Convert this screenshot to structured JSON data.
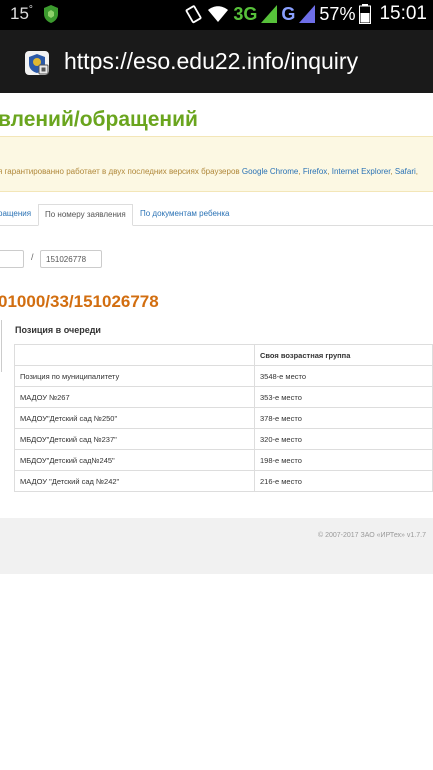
{
  "status_bar": {
    "temperature": "15",
    "temperature_unit": "°",
    "network_type": "3G",
    "network_type2": "G",
    "battery": "57%",
    "time": "15:01"
  },
  "browser": {
    "url": "https://eso.edu22.info/inquiry"
  },
  "page": {
    "title": "влений/обращений",
    "notice_prefix": "я гарантированно работает в двух последних версиях браузеров ",
    "browsers": [
      "Google Chrome",
      "Firefox",
      "Internet Explorer",
      "Safari"
    ],
    "tabs": [
      {
        "label": "ращения",
        "active": false
      },
      {
        "label": "По номеру заявления",
        "active": true
      },
      {
        "label": "По документам ребенка",
        "active": false
      }
    ],
    "separator": "/",
    "number_field_value": "151026778",
    "application_number": "01000/33/151026778",
    "queue_heading": "Позиция в очереди",
    "table": {
      "headers": [
        "",
        "Своя возрастная группа"
      ],
      "rows": [
        [
          "Позиция по муниципалитету",
          "3548-е место"
        ],
        [
          "МАДОУ №267",
          "353-е место"
        ],
        [
          "МАДОУ\"Детский сад №250\"",
          "378-е место"
        ],
        [
          "МБДОУ\"Детский сад №237\"",
          "320-е место"
        ],
        [
          "МБДОУ\"Детский сад№245\"",
          "198-е место"
        ],
        [
          "МАДОУ \"Детский сад №242\"",
          "216-е место"
        ]
      ]
    },
    "footer": "© 2007-2017 ЗАО «ИРТех» v1.7.7"
  },
  "colors": {
    "title_green": "#6aa51e",
    "number_orange": "#d26e10",
    "link_blue": "#2a72b5",
    "notice_bg": "#fcf8e3"
  }
}
